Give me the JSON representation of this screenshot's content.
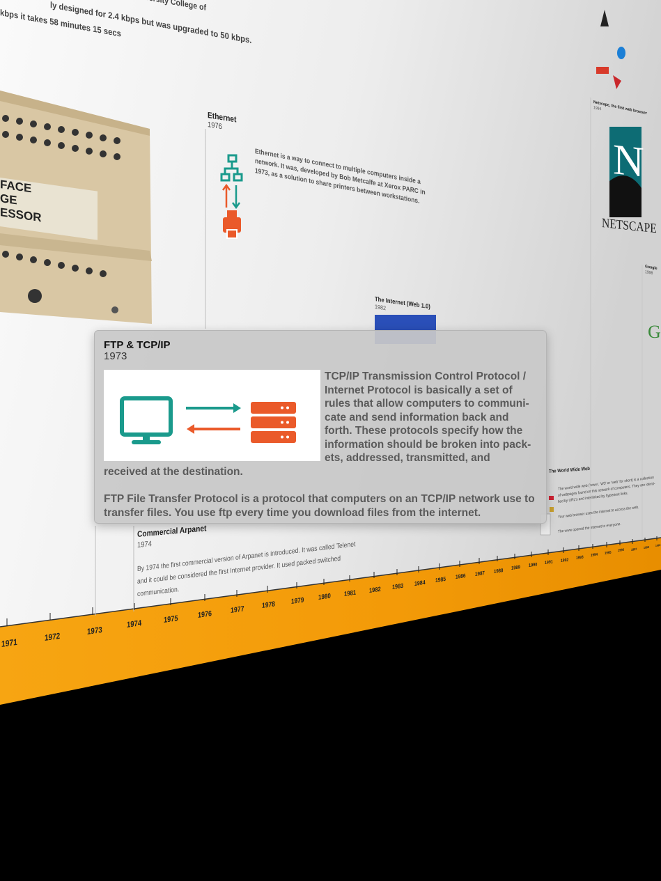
{
  "top_text": {
    "line1a": "ly designed for 2.4 kbps but was upgraded to 50 kbps.",
    "line1b": "iversity College of",
    "line2": "kbps it takes 58 minutes 15 secs"
  },
  "imp_panel": {
    "row1": "FACE",
    "row2": "GE",
    "row3": "ESSOR"
  },
  "ethernet": {
    "title": "Ethernet",
    "year": "1976",
    "desc_lines": [
      "Ethernet is a way to connect to multiple computers inside a",
      "network. It was, developed by Bob Metcalfe at Xerox PARC in",
      "1973, as a solution to share printers between workstations."
    ]
  },
  "internet": {
    "title": "The Internet (Web 1.0)",
    "year": "1982"
  },
  "netscape": {
    "title": "Netscape, the first web browser",
    "year": "1994",
    "logo_letter": "N",
    "logo_text": "NETSCAPE"
  },
  "google": {
    "title": "Google",
    "year": "1998",
    "logo_partial": "G"
  },
  "www": {
    "title": "The World Wide Web",
    "lines": [
      "The world wide web ('www', 'W3' or 'web' for short) is a collection",
      "of webpages found on this network of computers. They are identi-",
      "fied by URL's and interlinked by hypertext links.",
      "Your web browser uses the internet to access the web.",
      "The www opened the internet to everyone."
    ]
  },
  "commercial_arpanet": {
    "title": "Commercial Arpanet",
    "year": "1974",
    "lines": [
      "By 1974 the first commercial version of Arpanet is introduced. It was called Telenet",
      "and it could be considered the first Internet provider. It used packed switched",
      "communication."
    ]
  },
  "popup": {
    "title": "FTP & TCP/IP",
    "year": "1973",
    "para1": "TCP/IP Transmission Control Protocol / Internet Protocol is basically a set of rules that allow computers to communi-cate and send information back and forth. These protocols specify how the information should be broken into pack-ets, addressed, transmitted, and received at the destination.",
    "para2": "FTP File Transfer Protocol is a protocol that computers on an TCP/IP network use to transfer files. You use ftp every time you download files from the internet."
  },
  "timeline_years": [
    "1971",
    "1972",
    "1973",
    "1974",
    "1975",
    "1976",
    "1977",
    "1978",
    "1979",
    "1980",
    "1981",
    "1982",
    "1983",
    "1984",
    "1985",
    "1986",
    "1987",
    "1988",
    "1989",
    "1990",
    "1991",
    "1992",
    "1993",
    "1994",
    "1995",
    "1996",
    "1997",
    "1998",
    "1999"
  ],
  "colors": {
    "timeline": "#f59a0c",
    "teal": "#1a9a8c",
    "orange_red": "#ea5a2a",
    "wall_light": "#f7f7f7",
    "wall_dark": "#d6d6d6"
  },
  "icons": {
    "network": "network-icon",
    "printer": "printer-icon",
    "monitor": "monitor-icon",
    "server": "server-icon",
    "arrows": "transfer-arrows-icon"
  }
}
